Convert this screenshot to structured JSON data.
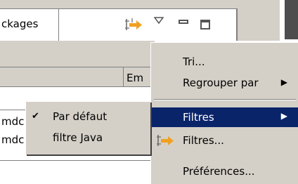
{
  "view": {
    "tab_label": "ckages",
    "column_header": "Em",
    "rows": [
      "mdc",
      "mdc"
    ]
  },
  "menu": {
    "items": [
      {
        "label": "Tri..."
      },
      {
        "label": "Regrouper par",
        "has_submenu": true
      },
      {
        "label": "Filtres",
        "has_submenu": true,
        "highlighted": true
      },
      {
        "label": "Filtres...",
        "icon": "filter-icon"
      },
      {
        "label": "Préférences..."
      }
    ],
    "submenu_arrow": "▶"
  },
  "submenu": {
    "items": [
      {
        "label": "Par défaut",
        "checked": true,
        "check": "✔"
      },
      {
        "label": "filtre Java",
        "checked": false
      }
    ]
  },
  "colors": {
    "background": "#d4d0c8",
    "highlight": "#0a246a",
    "highlight_text": "#ffffff",
    "sync_arrow_orange": "#f0a020"
  }
}
